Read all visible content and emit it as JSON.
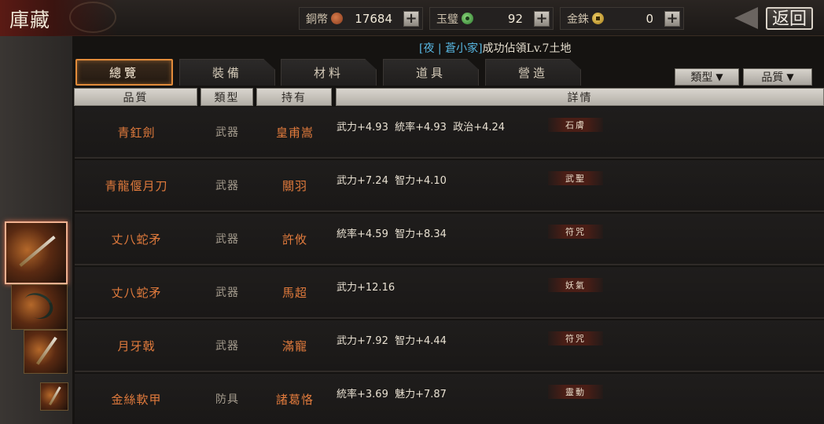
{
  "header": {
    "title": "庫藏",
    "resources": [
      {
        "label": "銅幣",
        "icon": "copper-coin-icon",
        "value": "17684"
      },
      {
        "label": "玉璧",
        "icon": "jade-disc-icon",
        "value": "92"
      },
      {
        "label": "金銖",
        "icon": "gold-coin-icon",
        "value": "0"
      }
    ],
    "plus_label": "+",
    "back_label": "返回"
  },
  "notice": {
    "prefix": "[",
    "team": "夜",
    "separator": " | ",
    "player": "蒼小家",
    "suffix": "]",
    "message": "成功佔領Lv.7土地"
  },
  "tabs": [
    {
      "label": "總覽",
      "active": true
    },
    {
      "label": "裝備",
      "active": false
    },
    {
      "label": "材料",
      "active": false
    },
    {
      "label": "道具",
      "active": false
    },
    {
      "label": "營造",
      "active": false
    }
  ],
  "filters": {
    "type_label": "類型",
    "quality_label": "品質",
    "caret": "▼"
  },
  "columns": [
    "品質",
    "類型",
    "持有",
    "詳情"
  ],
  "items": [
    {
      "name": "青釭劍",
      "type": "武器",
      "owner": "皇甫嵩",
      "stats": "武力+4.93  統率+4.93  政治+4.24",
      "badge": "石膚"
    },
    {
      "name": "青龍偃月刀",
      "type": "武器",
      "owner": "關羽",
      "stats": "武力+7.24  智力+4.10",
      "badge": "武聖"
    },
    {
      "name": "丈八蛇矛",
      "type": "武器",
      "owner": "許攸",
      "stats": "統率+4.59  智力+8.34",
      "badge": "符咒"
    },
    {
      "name": "丈八蛇矛",
      "type": "武器",
      "owner": "馬超",
      "stats": "武力+12.16",
      "badge": "妖氣"
    },
    {
      "name": "月牙戟",
      "type": "武器",
      "owner": "滿寵",
      "stats": "武力+7.92  智力+4.44",
      "badge": "符咒"
    },
    {
      "name": "金絲軟甲",
      "type": "防具",
      "owner": "諸葛恪",
      "stats": "統率+3.69  魅力+7.87",
      "badge": "靈動"
    }
  ],
  "thumbnails": [
    {
      "icon": "sword-thumbnail-icon",
      "selected": true
    },
    {
      "icon": "curved-blade-thumbnail-icon",
      "selected": false
    },
    {
      "icon": "spear-thumbnail-icon",
      "selected": false
    },
    {
      "icon": "halberd-thumbnail-icon",
      "selected": false
    }
  ],
  "colors": {
    "accent_orange": "#e07a3c",
    "tab_active_border": "#e28b3a",
    "notice_blue": "#58b7e2",
    "title_red": "#5a1a14"
  }
}
